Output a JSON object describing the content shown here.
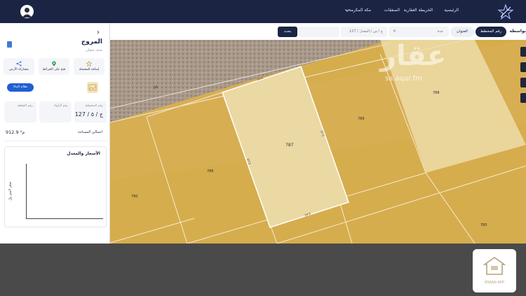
{
  "nav": {
    "home": "الرئيسية",
    "map": "الخريطة العقارية",
    "deals": "الصفقات",
    "mecca": "مكة المكرمة"
  },
  "search": {
    "by_label": "بواسطة",
    "tab_plan": "رقم المخطط",
    "tab_address": "العنوان",
    "city_value": "جدة",
    "plot_value": "127 / ج / س / المعدل",
    "button": "بحث"
  },
  "sidebar": {
    "district": "المروج",
    "city": "جدة، حيفان",
    "actions": {
      "favorite": "إضافة للمفضلة",
      "open_map": "فتح على الخرائط",
      "share": "مشاركة الأرض"
    },
    "build_button": "نظام البناء",
    "info": {
      "plan_label": "رقم المخطط",
      "plan_value": "127 / ج / ٥",
      "blocks_label": "رقم البلوك",
      "plot_label": "رقم القطعة"
    },
    "area_label": "اجمالي المساحة",
    "area_value": "912.9 م²",
    "chart_title": "الأسعار والمعدل",
    "chart_ylabel": "سعر المتر ﷼"
  },
  "map": {
    "watermark_ar": "عقار",
    "watermark_en": "sa.aqar.fm",
    "parcels": {
      "center": "787",
      "top_right": "788",
      "left": "786",
      "right": "789",
      "far_right": "790",
      "bottom_right": "785",
      "dim_left": "37.5",
      "dim_right": "37.5",
      "dim_top": "21.5",
      "dim_bottom": "24.5",
      "road": "36"
    }
  },
  "brand": {
    "subtitle": "ESKAN APP"
  },
  "colors": {
    "navy": "#1c2444",
    "accent_blue": "#1f5fd2",
    "map_sand": "#d6ad4d"
  }
}
